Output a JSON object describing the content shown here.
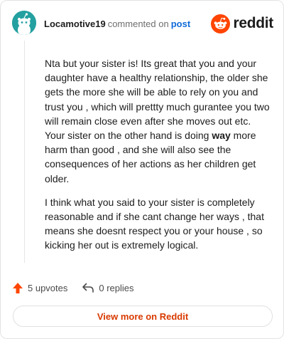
{
  "header": {
    "username": "Locamotive19",
    "commented_text": "commented on",
    "post_link": "post",
    "logo_text": "reddit"
  },
  "comment": {
    "paragraph1": {
      "before": "Nta but your sister is! Its great that you and your daughter have a healthy relationship, the older she gets the more she will be able to rely on you and trust you , which will prettty much gurantee you two will remain close even after she moves out etc. Your sister on the other hand is doing ",
      "emphasis": "way",
      "after": " more harm than good , and she will also see the consequences of her actions as her children get older."
    },
    "paragraph2": "I think what you said to your sister is completely reasonable and if she cant change her ways , that means she doesnt respect you or your house , so kicking her out is extremely logical."
  },
  "actions": {
    "upvotes": "5 upvotes",
    "replies": "0 replies"
  },
  "view_more_label": "View more on Reddit",
  "colors": {
    "accent": "#ff4500",
    "link": "#0f6bd8",
    "avatar_bg": "#24a0a0"
  },
  "icons": [
    "snoo-avatar-icon",
    "reddit-logo-icon",
    "upvote-arrow-icon",
    "reply-arrow-icon"
  ]
}
